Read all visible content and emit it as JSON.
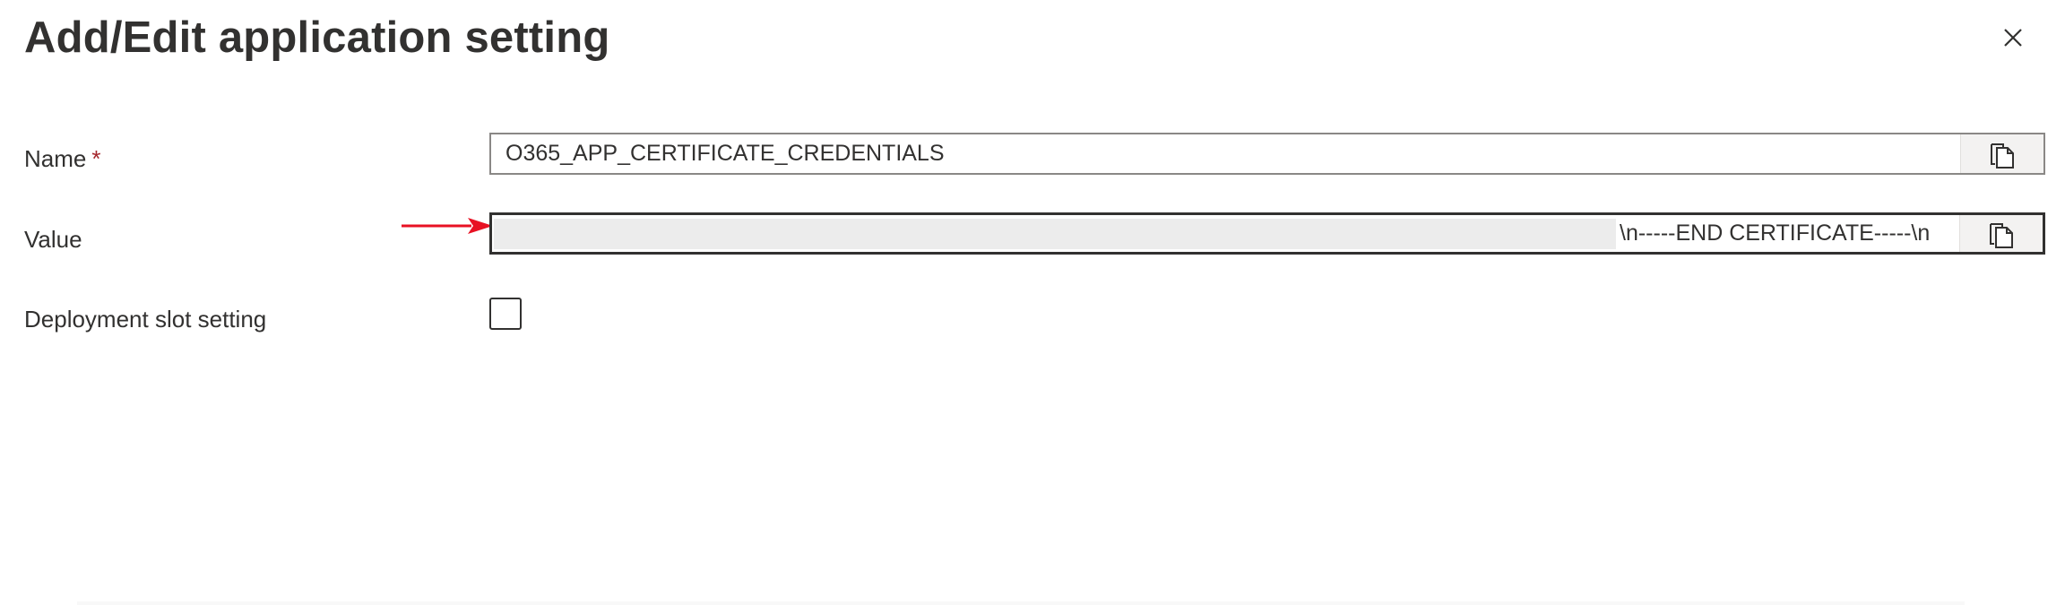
{
  "dialog": {
    "title": "Add/Edit application setting",
    "close_icon": "close-icon"
  },
  "form": {
    "name": {
      "label": "Name",
      "required_marker": "*",
      "value": "O365_APP_CERTIFICATE_CREDENTIALS",
      "copy_icon": "copy-icon"
    },
    "value": {
      "label": "Value",
      "visible_tail": "\\n-----END CERTIFICATE-----\\n",
      "redacted": true,
      "copy_icon": "copy-icon"
    },
    "deployment_slot": {
      "label": "Deployment slot setting",
      "checked": false
    }
  },
  "annotation": {
    "arrow_icon": "red-arrow-icon",
    "arrow_color": "#e81123"
  }
}
